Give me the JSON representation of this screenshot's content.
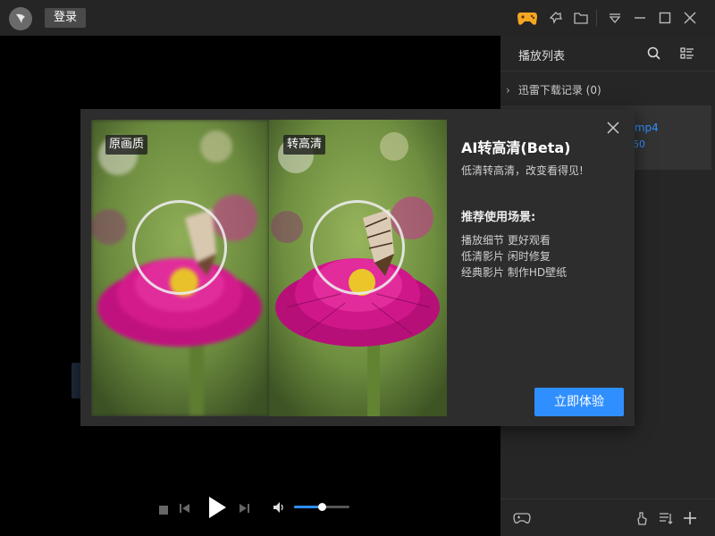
{
  "header": {
    "login_label": "登录",
    "icons": [
      "app-logo",
      "game-icon",
      "pin-icon",
      "folder-icon",
      "menu-dropdown-icon",
      "minimize-icon",
      "maximize-icon",
      "close-icon"
    ]
  },
  "playlist": {
    "title": "播放列表",
    "history_label": "迅雷下载记录 (0)",
    "item_name": ".mp4",
    "item_size": "50",
    "icons": [
      "search-icon",
      "list-view-icon",
      "gamepad-icon",
      "clean-icon",
      "sort-icon",
      "add-icon"
    ]
  },
  "player": {
    "volume": 0.5,
    "icons": [
      "stop-icon",
      "previous-icon",
      "play-icon",
      "next-icon",
      "volume-icon"
    ]
  },
  "modal": {
    "title": "AI转高清(Beta)",
    "subtitle": "低清转高清，改变看得见!",
    "heading": "推荐使用场景:",
    "lines": [
      "播放细节 更好观看",
      "低清影片 闲时修复",
      "经典影片 制作HD壁纸"
    ],
    "button": "立即体验",
    "tag_original": "原画质",
    "tag_enhanced": "转高清"
  },
  "colors": {
    "accent": "#2f8fff",
    "titlebar": "#252525",
    "panel": "#262626",
    "modal": "#2d2d2d",
    "game_icon": "#f5a623"
  }
}
